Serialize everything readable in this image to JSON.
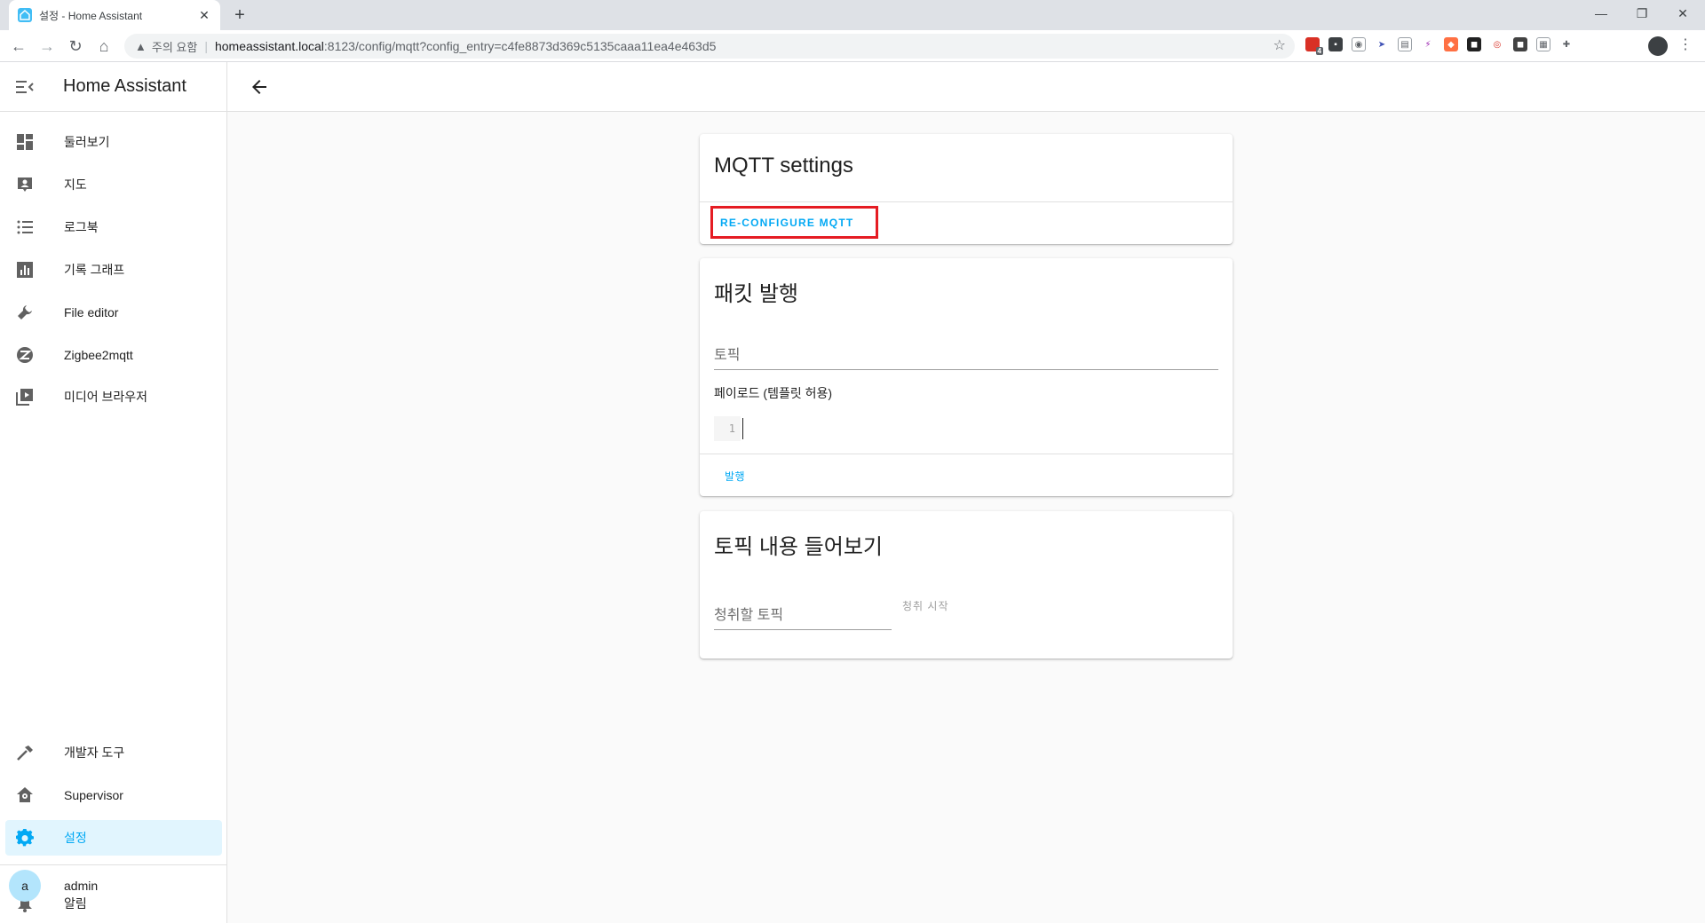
{
  "browser": {
    "tab_title": "설정 - Home Assistant",
    "warning_text": "주의 요함",
    "url_host": "homeassistant.local",
    "url_path": ":8123/config/mqtt?config_entry=c4fe8873d369c5135caaa11ea4e463d5",
    "extension_badge": "4"
  },
  "sidebar": {
    "title": "Home Assistant",
    "items": [
      {
        "label": "둘러보기",
        "icon": "dashboard-icon"
      },
      {
        "label": "지도",
        "icon": "map-icon"
      },
      {
        "label": "로그북",
        "icon": "logbook-icon"
      },
      {
        "label": "기록 그래프",
        "icon": "chart-icon"
      },
      {
        "label": "File editor",
        "icon": "wrench-icon"
      },
      {
        "label": "Zigbee2mqtt",
        "icon": "zigbee-icon"
      },
      {
        "label": "미디어 브라우저",
        "icon": "media-icon"
      }
    ],
    "bottom_items": [
      {
        "label": "개발자 도구",
        "icon": "hammer-icon"
      },
      {
        "label": "Supervisor",
        "icon": "supervisor-icon"
      },
      {
        "label": "설정",
        "icon": "cog-icon",
        "active": true
      }
    ],
    "notifications_label": "알림",
    "user_label": "admin",
    "user_initial": "a"
  },
  "mqtt_settings": {
    "title": "MQTT settings",
    "reconfigure_label": "RE-CONFIGURE MQTT"
  },
  "publish": {
    "title": "패킷 발행",
    "topic_label": "토픽",
    "payload_label": "페이로드 (템플릿 허용)",
    "line_number": "1",
    "publish_button": "발행"
  },
  "listen": {
    "title": "토픽 내용 들어보기",
    "topic_label": "청취할 토픽",
    "start_button": "청취 시작"
  },
  "colors": {
    "accent": "#03a9f4",
    "highlight_border": "#e51c23",
    "active_bg": "#e1f5fe"
  }
}
